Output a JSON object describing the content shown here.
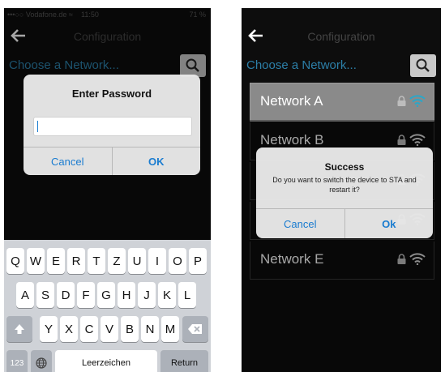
{
  "left": {
    "status": {
      "carrier": "•••○○ Vodafone.de ≈",
      "time": "11:50",
      "battery": "71 %"
    },
    "nav_title": "Configuration",
    "choose_label": "Choose a Network...",
    "password_alert": {
      "title": "Enter Password",
      "cancel": "Cancel",
      "ok": "OK",
      "input_value": ""
    },
    "keyboard": {
      "row1": [
        "Q",
        "W",
        "E",
        "R",
        "T",
        "Z",
        "U",
        "I",
        "O",
        "P"
      ],
      "row2": [
        "A",
        "S",
        "D",
        "F",
        "G",
        "H",
        "J",
        "K",
        "L"
      ],
      "row3": [
        "Y",
        "X",
        "C",
        "V",
        "B",
        "N",
        "M"
      ],
      "numbers_key": "123",
      "space_key": "Leerzeichen",
      "return_key": "Return"
    }
  },
  "right": {
    "nav_title": "Configuration",
    "choose_label": "Choose a Network...",
    "networks": [
      {
        "label": "Network A",
        "selected": true
      },
      {
        "label": "Network B",
        "selected": false
      },
      {
        "label": "",
        "selected": false
      },
      {
        "label": "",
        "selected": false
      },
      {
        "label": "Network E",
        "selected": false
      }
    ],
    "success_alert": {
      "title": "Success",
      "message": "Do you want to switch the device to STA and restart it?",
      "cancel": "Cancel",
      "ok": "Ok"
    }
  },
  "colors": {
    "accent": "#1a7cd0",
    "link": "#2c7fa8",
    "wifi": "#2aa7c9"
  }
}
